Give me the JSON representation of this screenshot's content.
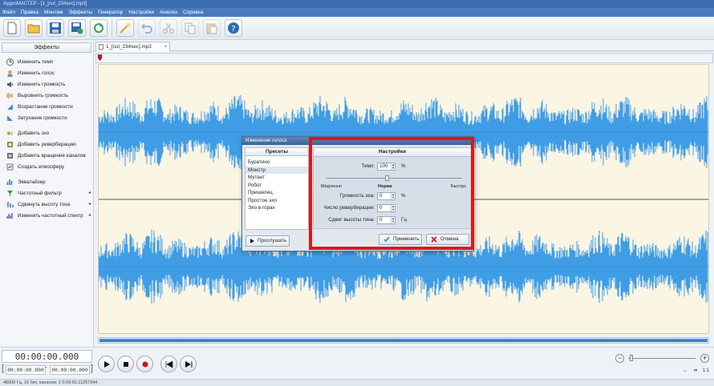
{
  "window": {
    "title": "АудиоМАСТЕР - [1_[cut_234sec].mp3]"
  },
  "menu": [
    "Файл",
    "Правка",
    "Монтаж",
    "Эффекты",
    "Генератор",
    "Настройки",
    "Анализ",
    "Справка"
  ],
  "toolbar": {
    "icons": [
      "new-file-icon",
      "open-folder-icon",
      "save-icon",
      "save-as-icon",
      "refresh-icon",
      "effect-icon",
      "undo-icon",
      "cut-icon",
      "copy-icon",
      "paste-icon",
      "help-icon"
    ]
  },
  "sidebar": {
    "title": "Эффекты",
    "items": [
      {
        "label": "Изменить темп",
        "icon": "tempo-icon"
      },
      {
        "label": "Изменить голос",
        "icon": "voice-icon"
      },
      {
        "label": "Изменить громкость",
        "icon": "volume-icon"
      },
      {
        "label": "Выровнять громкость",
        "icon": "normalize-icon"
      },
      {
        "label": "Возрастание громкости",
        "icon": "fade-in-icon"
      },
      {
        "label": "Затухание громкости",
        "icon": "fade-out-icon"
      },
      {
        "label": "Добавить эхо",
        "icon": "echo-icon"
      },
      {
        "label": "Добавить реверберацию",
        "icon": "reverb-icon"
      },
      {
        "label": "Добавить вращение каналов",
        "icon": "rotate-channels-icon"
      },
      {
        "label": "Создать атмосферу",
        "icon": "atmosphere-icon"
      },
      {
        "label": "Эквалайзер",
        "icon": "equalizer-icon"
      },
      {
        "label": "Частотный фильтр",
        "icon": "filter-icon"
      },
      {
        "label": "Сдвинуть высоту тона",
        "icon": "pitch-icon"
      },
      {
        "label": "Изменить частотный спектр",
        "icon": "spectrum-icon"
      }
    ]
  },
  "tab": {
    "label": "1_[cut_234sec].mp3",
    "close": "×"
  },
  "transport": {
    "time": "00:00:00.000",
    "start": "00:00:00.000",
    "end": "00:00:00.000",
    "dash": "-"
  },
  "zoom": {
    "minus": "−",
    "plus": "+",
    "fit": "1:1"
  },
  "status": "48000 Гц, 16 бит, каналов: 2   0:03:55.11257344",
  "dialog": {
    "title": "Изменение голоса",
    "presets_title": "Пресеты",
    "presets": [
      "Буратино",
      "Монстр",
      "Мутант",
      "Робот",
      "Пришелец",
      "Простое эхо",
      "Эхо в горах"
    ],
    "selected_preset": "Монстр",
    "listen_button": "Прослушать",
    "settings_title": "Настройки",
    "tempo_label": "Темп:",
    "tempo_value": "100",
    "tempo_unit": "%",
    "slider_slow": "Медленно",
    "slider_normal": "Норма",
    "slider_fast": "Быстро",
    "echo_label": "Громкость эха:",
    "echo_value": "0",
    "echo_unit": "%",
    "reverb_label": "Число реверберации:",
    "reverb_value": "0",
    "pitch_label": "Сдвиг высоты тона:",
    "pitch_value": "0",
    "pitch_unit": "Гц",
    "apply_button": "Применить",
    "cancel_button": "Отмена"
  },
  "colors": {
    "waveform": "#3f9de6",
    "highlight": "#e01616",
    "wave_bg": "#fbf5e4"
  }
}
